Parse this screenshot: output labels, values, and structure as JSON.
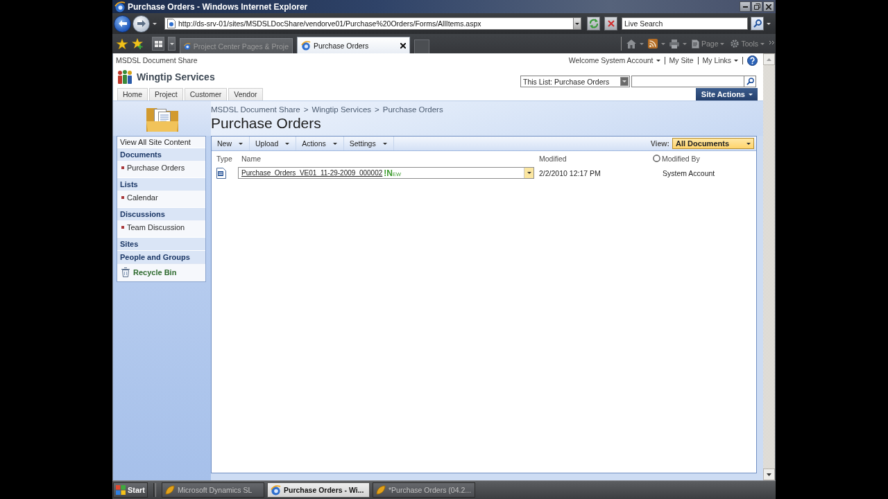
{
  "window": {
    "title": "Purchase Orders - Windows Internet Explorer"
  },
  "address_bar": {
    "url": "http://ds-srv-01/sites/MSDSLDocShare/vendorve01/Purchase%20Orders/Forms/AllItems.aspx"
  },
  "live_search": {
    "placeholder": "Live Search"
  },
  "browser_tabs": [
    {
      "label": "Project Center Pages & Proje",
      "selected": false
    },
    {
      "label": "Purchase Orders",
      "selected": true
    }
  ],
  "command_bar": [
    {
      "kind": "page",
      "label": "Page"
    },
    {
      "kind": "tools",
      "label": "Tools"
    }
  ],
  "page": {
    "site_title": "MSDSL Document Share",
    "user_menu": [
      {
        "label": "Welcome System Account",
        "dropdown": true
      },
      {
        "label": "My Site",
        "dropdown": false
      },
      {
        "label": "My Links",
        "dropdown": true
      }
    ],
    "site_name": "Wingtip Services",
    "search_scope": "This List: Purchase Orders",
    "top_nav": [
      {
        "label": "Home",
        "selected": false
      },
      {
        "label": "Project",
        "selected": false
      },
      {
        "label": "Customer",
        "selected": false
      },
      {
        "label": "Vendor",
        "selected": false
      }
    ],
    "site_actions": "Site Actions",
    "breadcrumb": [
      {
        "label": "MSDSL Document Share",
        "separator": ">"
      },
      {
        "label": "Wingtip Services",
        "separator": ">"
      },
      {
        "label": "Purchase Orders"
      }
    ],
    "page_title": "Purchase Orders",
    "quick_launch": [
      {
        "kind": "link",
        "label": "View All Site Content"
      },
      {
        "kind": "heading",
        "label": "Documents"
      },
      {
        "kind": "item",
        "label": "Purchase Orders"
      },
      {
        "kind": "heading",
        "label": "Lists"
      },
      {
        "kind": "item",
        "label": "Calendar"
      },
      {
        "kind": "heading",
        "label": "Discussions"
      },
      {
        "kind": "item",
        "label": "Team Discussion"
      },
      {
        "kind": "heading",
        "label": "Sites"
      },
      {
        "kind": "heading",
        "label": "People and Groups"
      },
      {
        "kind": "recycle",
        "label": "Recycle Bin"
      }
    ],
    "toolbar": {
      "menus": [
        "New",
        "Upload",
        "Actions",
        "Settings"
      ],
      "view_label": "View:",
      "view": "All Documents"
    },
    "columns": [
      {
        "label": "Type",
        "kind": "plain"
      },
      {
        "label": "Name",
        "kind": "plain"
      },
      {
        "label": "Modified",
        "kind": "plain"
      },
      {
        "label": "Modified By",
        "kind": "presence"
      }
    ],
    "rows": [
      {
        "name": "Purchase_Orders_VE01_11-29-2009_000002",
        "badge": "!NEW",
        "hovered": true,
        "modified": "2/2/2010 12:17 PM",
        "modified_by": "System Account"
      }
    ]
  },
  "taskbar": {
    "start": "Start",
    "items": [
      {
        "label": "Microsoft Dynamics SL",
        "kind": "app",
        "selected": false
      },
      {
        "label": "Purchase Orders - Wi...",
        "kind": "browser",
        "selected": true
      },
      {
        "label": "*Purchase Orders (04.2...",
        "kind": "app",
        "selected": false
      }
    ]
  }
}
